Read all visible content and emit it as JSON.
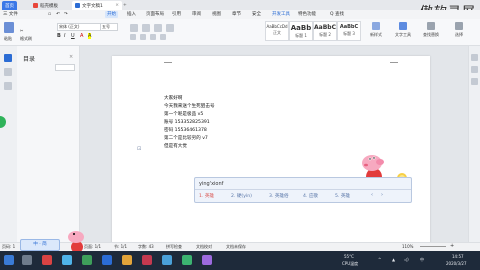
{
  "tabs": {
    "home": "首页",
    "template": "稻壳模板",
    "document": "文字文稿1"
  },
  "watermark": "傲软录屏",
  "menu": [
    "三 文件",
    "开始",
    "插入",
    "页面布局",
    "引用",
    "审阅",
    "视图",
    "章节",
    "安全",
    "开发工具",
    "特色功能"
  ],
  "active_menu": "开始",
  "search_label": "Q 查找",
  "ribbon": {
    "paste": "粘贴",
    "format_painter": "格式刷",
    "font_name": "宋体 (正文)",
    "font_size": "五号",
    "bold": "B",
    "italic": "I",
    "underline": "U",
    "styles": [
      {
        "sample": "AaBbCcDd",
        "name": "正文"
      },
      {
        "sample": "AaBb",
        "name": "标题 1"
      },
      {
        "sample": "AaBbC",
        "name": "标题 2"
      },
      {
        "sample": "AaBbC",
        "name": "标题 3"
      }
    ],
    "new_style": "新样式",
    "text_tools": "文字工具",
    "find_replace": "查找替换",
    "select": "选择"
  },
  "nav": {
    "title": "目录"
  },
  "document": {
    "lines": [
      "大家好啊",
      "今天我来送个生死狙击号",
      "第一个呢是极品 v5",
      "账号 153352825391",
      "密码 15536461378",
      "第二个是比较穷的 v7",
      "但是有大觉"
    ]
  },
  "ime": {
    "composition": "ying'xionf",
    "candidates": [
      "1. 英雄",
      "2. 硬(yìn)",
      "3. 英雄俗",
      "4. 应敬",
      "5. 英雄"
    ]
  },
  "statusbar": {
    "page_info": "页码: 1",
    "page_count": "页面: 1/1",
    "section": "节: 1/1",
    "word_count": "字数: 43",
    "spell_check": "拼写检查",
    "doc_check": "文档校对",
    "doc_unsaved": "文档未保存",
    "zoom": "110%"
  },
  "taskbar": {
    "ime_float": "中 · 简",
    "cpu_label": "55°C",
    "cpu_sub": "CPU温度",
    "time": "14:57",
    "date": "2020/3/27"
  },
  "colors": {
    "accent": "#2b6cd4",
    "taskbar": "#1e2a3a",
    "candidate": "#d9534f"
  }
}
